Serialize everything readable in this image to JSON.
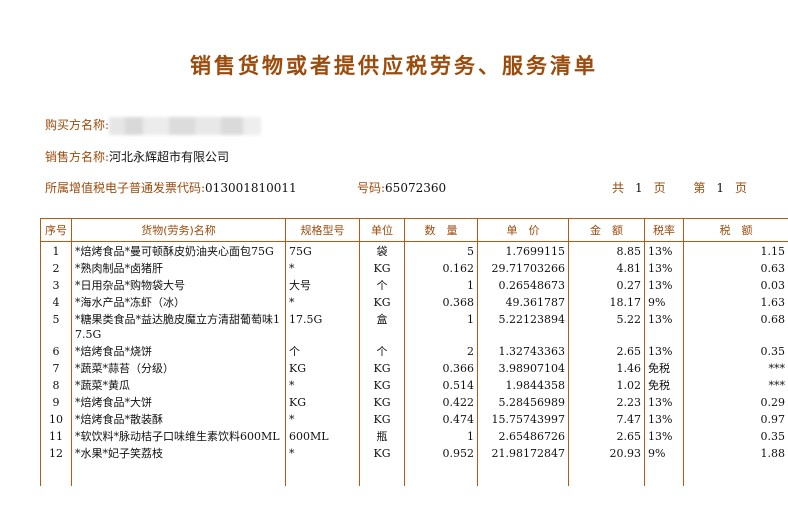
{
  "title": "销售货物或者提供应税劳务、服务清单",
  "buyer": {
    "label": "购买方名称:",
    "value": ""
  },
  "seller": {
    "label": "销售方名称:",
    "value": "河北永辉超市有限公司"
  },
  "invoice_code": {
    "label": "所属增值税电子普通发票代码:",
    "value": "013001810011"
  },
  "invoice_number": {
    "label": "号码:",
    "value": "65072360"
  },
  "page_info": {
    "total_label": "共",
    "total": "1",
    "unit1": "页",
    "page_label": "第",
    "page": "1",
    "unit2": "页"
  },
  "table": {
    "headers": [
      "序号",
      "货物(劳务)名称",
      "规格型号",
      "单位",
      "数　量",
      "单　价",
      "金　额",
      "税率",
      "税　额"
    ],
    "rows": [
      {
        "no": "1",
        "name": "*焙烤食品*曼可顿酥皮奶油夹心面包75G",
        "spec": "75G",
        "unit": "袋",
        "qty": "5",
        "price": "1.7699115",
        "amount": "8.85",
        "rate": "13%",
        "tax": "1.15"
      },
      {
        "no": "2",
        "name": "*熟肉制品*卤猪肝",
        "spec": "*",
        "unit": "KG",
        "qty": "0.162",
        "price": "29.71703266",
        "amount": "4.81",
        "rate": "13%",
        "tax": "0.63"
      },
      {
        "no": "3",
        "name": "*日用杂品*购物袋大号",
        "spec": "大号",
        "unit": "个",
        "qty": "1",
        "price": "0.26548673",
        "amount": "0.27",
        "rate": "13%",
        "tax": "0.03"
      },
      {
        "no": "4",
        "name": "*海水产品*冻虾（冰）",
        "spec": "*",
        "unit": "KG",
        "qty": "0.368",
        "price": "49.361787",
        "amount": "18.17",
        "rate": "9%",
        "tax": "1.63"
      },
      {
        "no": "5",
        "name": "*糖果类食品*益达脆皮魔立方清甜葡萄味17.5G",
        "spec": "17.5G",
        "unit": "盒",
        "qty": "1",
        "price": "5.22123894",
        "amount": "5.22",
        "rate": "13%",
        "tax": "0.68"
      },
      {
        "no": "6",
        "name": "*焙烤食品*烧饼",
        "spec": "个",
        "unit": "个",
        "qty": "2",
        "price": "1.32743363",
        "amount": "2.65",
        "rate": "13%",
        "tax": "0.35"
      },
      {
        "no": "7",
        "name": "*蔬菜*蒜苔（分级）",
        "spec": "KG",
        "unit": "KG",
        "qty": "0.366",
        "price": "3.98907104",
        "amount": "1.46",
        "rate": "免税",
        "tax": "***"
      },
      {
        "no": "8",
        "name": "*蔬菜*黄瓜",
        "spec": "*",
        "unit": "KG",
        "qty": "0.514",
        "price": "1.9844358",
        "amount": "1.02",
        "rate": "免税",
        "tax": "***"
      },
      {
        "no": "9",
        "name": "*焙烤食品*大饼",
        "spec": "KG",
        "unit": "KG",
        "qty": "0.422",
        "price": "5.28456989",
        "amount": "2.23",
        "rate": "13%",
        "tax": "0.29"
      },
      {
        "no": "10",
        "name": "*焙烤食品*散装酥",
        "spec": "*",
        "unit": "KG",
        "qty": "0.474",
        "price": "15.75743997",
        "amount": "7.47",
        "rate": "13%",
        "tax": "0.97"
      },
      {
        "no": "11",
        "name": "*软饮料*脉动桔子口味维生素饮料600ML",
        "spec": "600ML",
        "unit": "瓶",
        "qty": "1",
        "price": "2.65486726",
        "amount": "2.65",
        "rate": "13%",
        "tax": "0.35"
      },
      {
        "no": "12",
        "name": "*水果*妃子笑荔枝",
        "spec": "*",
        "unit": "KG",
        "qty": "0.952",
        "price": "21.98172847",
        "amount": "20.93",
        "rate": "9%",
        "tax": "1.88"
      }
    ]
  }
}
